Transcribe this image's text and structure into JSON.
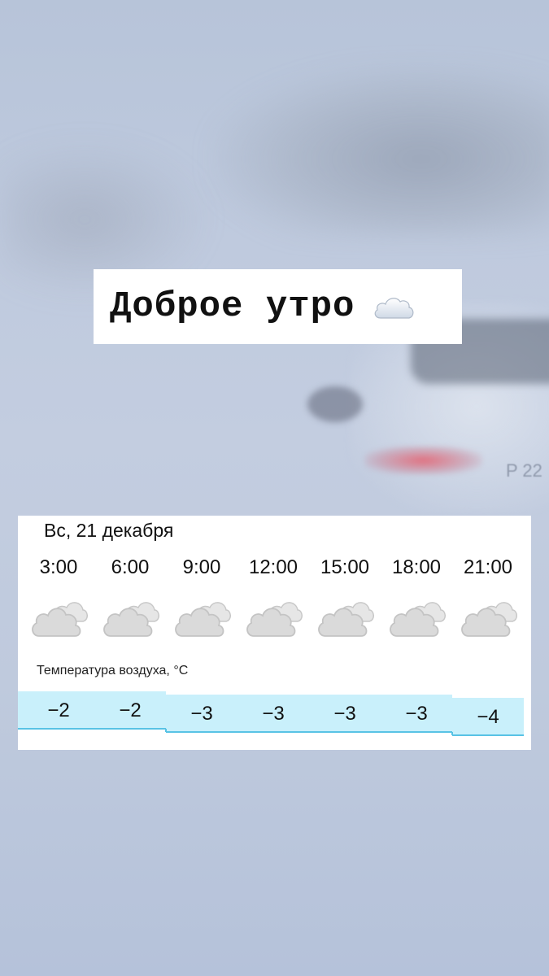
{
  "greeting": {
    "text": "Доброе утро",
    "emoji_icon": "cloud-icon"
  },
  "forecast": {
    "date": "Вс, 21 декабря",
    "temperature_label": "Температура воздуха, °C",
    "colors": {
      "band_fill": "#c9f0fb",
      "band_line": "#58c3e5",
      "icon_gray": "#dadada"
    }
  },
  "background": {
    "plate_fragment": "P 22"
  },
  "chart_data": {
    "type": "step-area",
    "title": "Температура воздуха, °C",
    "categories": [
      "3:00",
      "6:00",
      "9:00",
      "12:00",
      "15:00",
      "18:00",
      "21:00"
    ],
    "conditions": [
      "cloudy",
      "cloudy",
      "cloudy",
      "cloudy",
      "cloudy",
      "cloudy",
      "cloudy"
    ],
    "values": [
      -2,
      -2,
      -3,
      -3,
      -3,
      -3,
      -4
    ],
    "value_labels": [
      "−2",
      "−2",
      "−3",
      "−3",
      "−3",
      "−3",
      "−4"
    ],
    "grid": false
  }
}
